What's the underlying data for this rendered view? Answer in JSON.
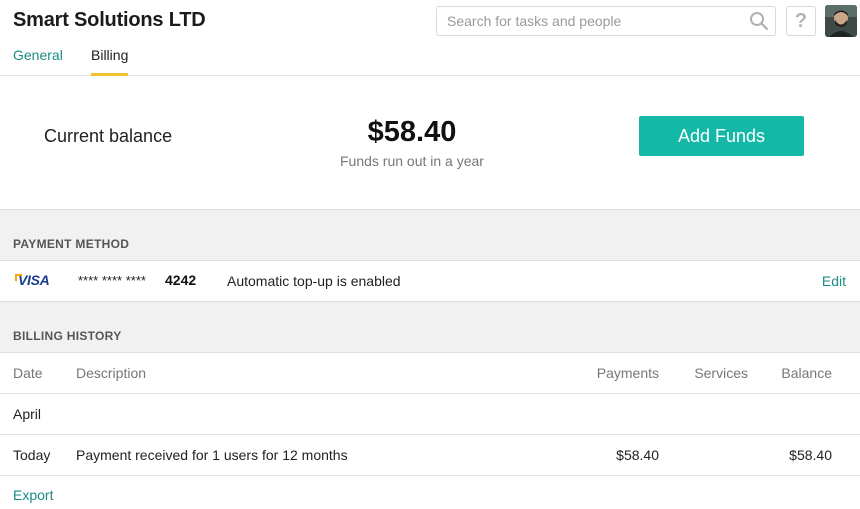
{
  "header": {
    "company": "Smart Solutions LTD",
    "search_placeholder": "Search for tasks and people",
    "help_label": "?"
  },
  "tabs": [
    {
      "label": "General",
      "active": false
    },
    {
      "label": "Billing",
      "active": true
    }
  ],
  "balance": {
    "label": "Current balance",
    "amount": "$58.40",
    "note": "Funds run out in a year",
    "add_funds_label": "Add Funds"
  },
  "payment_method": {
    "title": "PAYMENT METHOD",
    "brand": "VISA",
    "masked": "**** **** ****",
    "last4": "4242",
    "status": "Automatic top-up is enabled",
    "edit_label": "Edit"
  },
  "billing_history": {
    "title": "BILLING HISTORY",
    "columns": [
      "Date",
      "Description",
      "Payments",
      "Services",
      "Balance"
    ],
    "group_label": "April",
    "rows": [
      {
        "date": "Today",
        "description": "Payment received for 1 users for 12 months",
        "payments": "$58.40",
        "services": "",
        "balance": "$58.40"
      }
    ],
    "export_label": "Export"
  },
  "colors": {
    "accent": "#14b8a6",
    "link": "#1a8c85",
    "tab_underline": "#f2c230",
    "section_bg": "#f1f1f1"
  },
  "icons": [
    "search-icon",
    "help-icon",
    "user-avatar"
  ]
}
